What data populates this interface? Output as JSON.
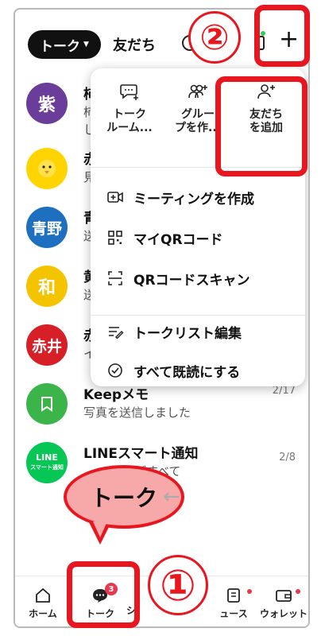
{
  "header": {
    "talk_tab": "トーク",
    "friends_tab": "友だち",
    "plus_icon": "plus-icon"
  },
  "chats": [
    {
      "avatar": "紫",
      "avatar_color": "#6a3d9a",
      "name": "柿",
      "message": "柿\nし",
      "date": ""
    },
    {
      "avatar": "",
      "avatar_color": "#ffd400",
      "name": "赤",
      "message": "見",
      "date": ""
    },
    {
      "avatar": "青野",
      "avatar_color": "#1e6fbf",
      "name": "青",
      "message": "送",
      "date": ""
    },
    {
      "avatar": "和",
      "avatar_color": "#f5c400",
      "name": "黄",
      "message": "送",
      "date": ""
    },
    {
      "avatar": "赤井",
      "avatar_color": "#d61f26",
      "name": "赤",
      "message": "イ",
      "date": ""
    },
    {
      "avatar": "",
      "avatar_color": "#3bb54a",
      "name": "Keepメモ",
      "message": "写真を送信しました",
      "date": "2/17"
    },
    {
      "avatar": "LINE",
      "avatar_sub": "スマート通知",
      "avatar_color": "#06c755",
      "name": "LINEスマート通知",
      "message": "警報がすべて\n市 (15時3...",
      "date": "2/8"
    }
  ],
  "popup": {
    "top_options": [
      {
        "label": "トーク\nルーム...",
        "icon": "chat-room-add-icon"
      },
      {
        "label": "グルー\nプを作...",
        "icon": "group-add-icon"
      },
      {
        "label": "友だち\nを追加",
        "icon": "add-friend-icon"
      }
    ],
    "menu": [
      {
        "label": "ミーティングを作成",
        "icon": "video-icon"
      },
      {
        "label": "マイQRコード",
        "icon": "qr-code-icon"
      },
      {
        "label": "QRコードスキャン",
        "icon": "qr-scan-icon"
      },
      {
        "label": "トークリスト編集",
        "icon": "edit-list-icon"
      },
      {
        "label": "すべて既読にする",
        "icon": "check-circle-icon"
      }
    ]
  },
  "annotations": {
    "step1": "①",
    "step2": "②",
    "bubble_text": "トーク",
    "arrow": "←",
    "color": "#e8161e"
  },
  "bottom_nav": {
    "home": "ホーム",
    "talk": "トーク",
    "talk_badge": "3",
    "voom_partial": "シ",
    "news_partial": "ュース",
    "wallet": "ウォレット"
  }
}
